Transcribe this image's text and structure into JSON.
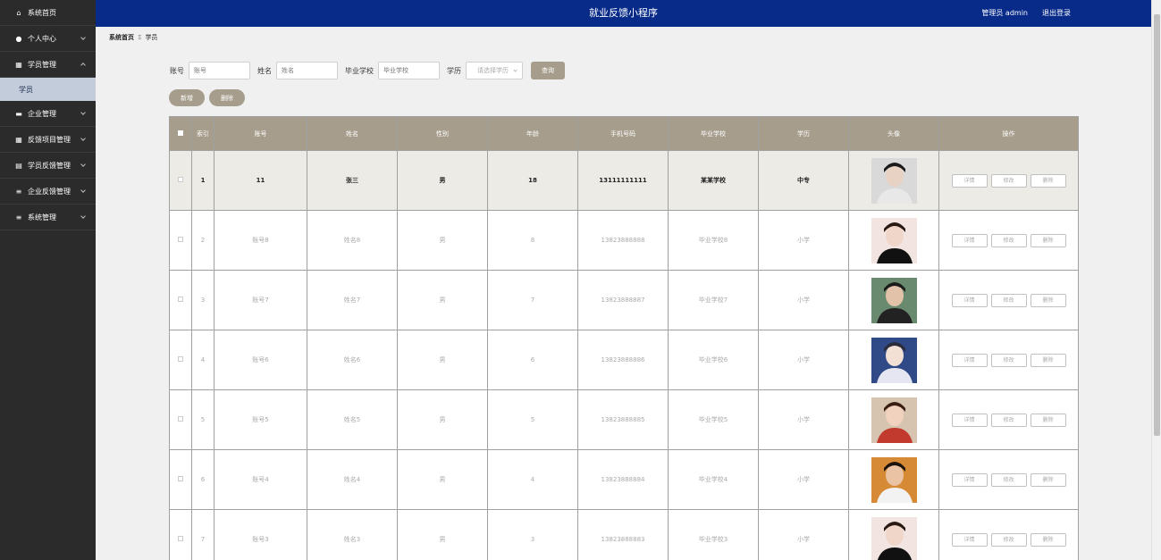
{
  "header": {
    "title": "就业反馈小程序",
    "admin_label": "管理员 admin",
    "logout_label": "退出登录"
  },
  "sidebar": {
    "items": [
      {
        "label": "系统首页",
        "icon": "home-icon"
      },
      {
        "label": "个人中心",
        "icon": "user-icon"
      },
      {
        "label": "学员管理",
        "icon": "grid-icon"
      },
      {
        "label": "企业管理",
        "icon": "monitor-icon"
      },
      {
        "label": "反馈项目管理",
        "icon": "grid-icon"
      },
      {
        "label": "学员反馈管理",
        "icon": "clipboard-icon"
      },
      {
        "label": "企业反馈管理",
        "icon": "list-icon"
      },
      {
        "label": "系统管理",
        "icon": "list-icon"
      }
    ],
    "sub_item": "学员"
  },
  "breadcrumb": {
    "home": "系统首页",
    "separator": "Ξ",
    "current": "学员"
  },
  "search": {
    "account_label": "账号",
    "account_placeholder": "账号",
    "name_label": "姓名",
    "name_placeholder": "姓名",
    "school_label": "毕业学校",
    "school_placeholder": "毕业学校",
    "edu_label": "学历",
    "edu_placeholder": "请选择学历",
    "query_label": "查询"
  },
  "actions": {
    "add_label": "新增",
    "delete_label": "删除"
  },
  "table": {
    "headers": {
      "index": "索引",
      "account": "账号",
      "name": "姓名",
      "gender": "性别",
      "age": "年龄",
      "phone": "手机号码",
      "school": "毕业学校",
      "education": "学历",
      "avatar": "头像",
      "ops": "操作"
    },
    "op_labels": {
      "detail": "详情",
      "edit": "修改",
      "delete": "删除"
    },
    "rows": [
      {
        "index": "1",
        "account": "11",
        "name": "张三",
        "gender": "男",
        "age": "18",
        "phone": "13111111111",
        "school": "某某学校",
        "education": "中专"
      },
      {
        "index": "2",
        "account": "账号8",
        "name": "姓名8",
        "gender": "男",
        "age": "8",
        "phone": "13823888888",
        "school": "毕业学校8",
        "education": "小学"
      },
      {
        "index": "3",
        "account": "账号7",
        "name": "姓名7",
        "gender": "男",
        "age": "7",
        "phone": "13823888887",
        "school": "毕业学校7",
        "education": "小学"
      },
      {
        "index": "4",
        "account": "账号6",
        "name": "姓名6",
        "gender": "男",
        "age": "6",
        "phone": "13823888886",
        "school": "毕业学校6",
        "education": "小学"
      },
      {
        "index": "5",
        "account": "账号5",
        "name": "姓名5",
        "gender": "男",
        "age": "5",
        "phone": "13823888885",
        "school": "毕业学校5",
        "education": "小学"
      },
      {
        "index": "6",
        "account": "账号4",
        "name": "姓名4",
        "gender": "男",
        "age": "4",
        "phone": "13823888884",
        "school": "毕业学校4",
        "education": "小学"
      },
      {
        "index": "7",
        "account": "账号3",
        "name": "姓名3",
        "gender": "男",
        "age": "3",
        "phone": "13823888883",
        "school": "毕业学校3",
        "education": "小学"
      }
    ]
  },
  "colors": {
    "header_bg": "#082a88",
    "sidebar_bg": "#2b2b2b",
    "accent_brown": "#a69d8c",
    "sub_item_bg": "#c2ccdb"
  }
}
